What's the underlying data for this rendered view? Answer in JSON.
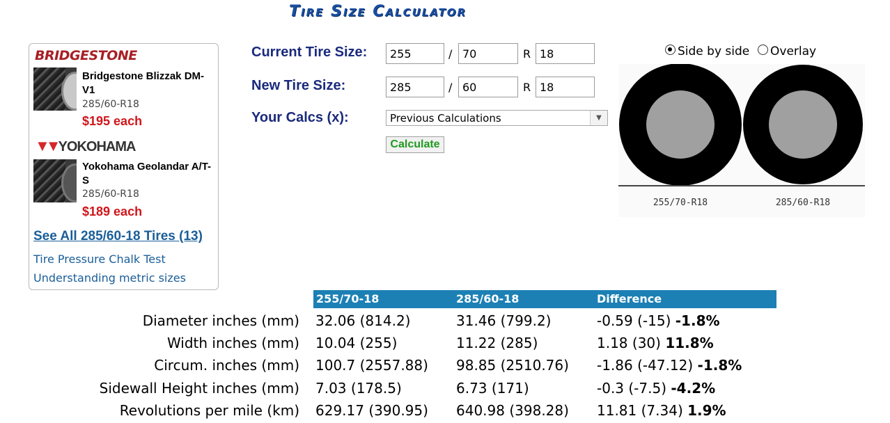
{
  "page_title": "Tire Size Calculator",
  "sidebar": {
    "products": [
      {
        "brand": "BRIDGESTONE",
        "name": "Bridgestone Blizzak DM-V1",
        "size": "285/60-R18",
        "price": "$195 each"
      },
      {
        "brand": "YOKOHAMA",
        "name": "Yokohama Geolandar A/T-S",
        "size": "285/60-R18",
        "price": "$189 each"
      }
    ],
    "see_all": "See All 285/60-18 Tires (13)",
    "links": [
      "Tire Pressure Chalk Test",
      "Understanding metric sizes"
    ]
  },
  "form": {
    "current_label": "Current Tire Size:",
    "new_label": "New Tire Size:",
    "calcs_label": "Your Calcs (x):",
    "current": {
      "width": "255",
      "ratio": "70",
      "rim": "18"
    },
    "new": {
      "width": "285",
      "ratio": "60",
      "rim": "18"
    },
    "slash": "/",
    "r": "R",
    "calcs_selected": "Previous Calculations",
    "calculate": "Calculate"
  },
  "view": {
    "side_by_side": "Side by side",
    "overlay": "Overlay",
    "selected": "side_by_side",
    "label_left": "255/70-R18",
    "label_right": "285/60-R18"
  },
  "table": {
    "headers": [
      "255/70-18",
      "285/60-18",
      "Difference"
    ],
    "rows": [
      {
        "label": "Diameter inches (mm)",
        "a": "32.06 (814.2)",
        "b": "31.46 (799.2)",
        "diff": "-0.59 (-15)",
        "pct": "-1.8%"
      },
      {
        "label": "Width inches (mm)",
        "a": "10.04 (255)",
        "b": "11.22 (285)",
        "diff": "1.18 (30)",
        "pct": "11.8%"
      },
      {
        "label": "Circum. inches (mm)",
        "a": "100.7 (2557.88)",
        "b": "98.85 (2510.76)",
        "diff": "-1.86 (-47.12)",
        "pct": "-1.8%"
      },
      {
        "label": "Sidewall Height inches (mm)",
        "a": "7.03 (178.5)",
        "b": "6.73 (171)",
        "diff": "-0.3 (-7.5)",
        "pct": "-4.2%"
      },
      {
        "label": "Revolutions per mile (km)",
        "a": "629.17 (390.95)",
        "b": "640.98 (398.28)",
        "diff": "11.81 (7.34)",
        "pct": "1.9%"
      }
    ]
  },
  "colors": {
    "accent": "#1c80b4",
    "price": "#d0161b",
    "link": "#1a5e98",
    "label": "#1a2a7c",
    "calc": "#1f9a20"
  }
}
